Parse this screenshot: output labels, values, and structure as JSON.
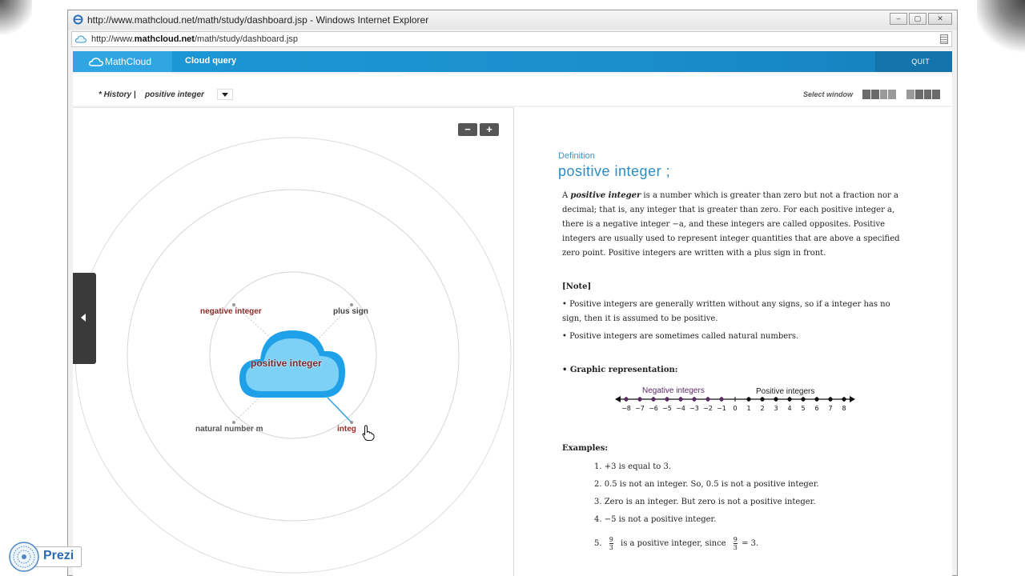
{
  "browser": {
    "title": "http://www.mathcloud.net/math/study/dashboard.jsp - Windows Internet Explorer",
    "url_prefix": "http://www.",
    "url_domain": "mathcloud.net",
    "url_path": "/math/study/dashboard.jsp",
    "controls": {
      "minimize": "–",
      "maximize": "▢",
      "close": "✕"
    }
  },
  "app": {
    "logo_text": "MathCloud",
    "nav_label": "Cloud query",
    "quit_label": "QUIT",
    "accent_color": "#1c97d6"
  },
  "history": {
    "label": "* History  |",
    "current": "positive integer",
    "select_window_label": "Select window"
  },
  "map": {
    "zoom_out": "−",
    "zoom_in": "+",
    "center": "positive integer",
    "nodes": {
      "negative": "negative integer",
      "plus_sign": "plus sign",
      "natural": "natural number m",
      "integer": "integ"
    }
  },
  "definition": {
    "kicker": "Definition",
    "title": "positive integer ;",
    "para_start": "A ",
    "para_term": "positive integer",
    "para_rest": " is a number which is greater than zero but not a fraction nor a decimal; that is, any integer that is greater than zero.  For each positive integer a, there is a negative integer −a, and these integers are called opposites.  Positive integers are usually used to represent integer quantities that are above a specified zero point.  Positive integers are written with a plus sign in front.",
    "note_title": "[Note]",
    "notes": [
      "• Positive integers are generally written without any signs, so if a integer has no sign, then it is assumed to be positive.",
      "• Positive integers are sometimes called natural numbers."
    ],
    "graphic_label": "• Graphic representation:",
    "numline": {
      "negative_label": "Negative integers",
      "positive_label": "Positive integers",
      "ticks": [
        "−8",
        "−7",
        "−6",
        "−5",
        "−4",
        "−3",
        "−2",
        "−1",
        "0",
        "1",
        "2",
        "3",
        "4",
        "5",
        "6",
        "7",
        "8"
      ],
      "negative_color": "#5a2b66",
      "positive_color": "#111111"
    },
    "examples_title": "Examples:",
    "examples": [
      "1.  +3  is equal to 3.",
      "2.  0.5  is not an integer.   So, 0.5 is not a positive integer.",
      "3.  Zero is an integer.   But zero is not a positive integer.",
      "4.  −5  is not a positive integer."
    ],
    "example5_prefix": "5.",
    "example5_middle": "is a positive integer, since",
    "example5_suffix": "= 3.",
    "fraction_num": "9",
    "fraction_den": "3"
  },
  "badge": {
    "text": "Prezi"
  }
}
